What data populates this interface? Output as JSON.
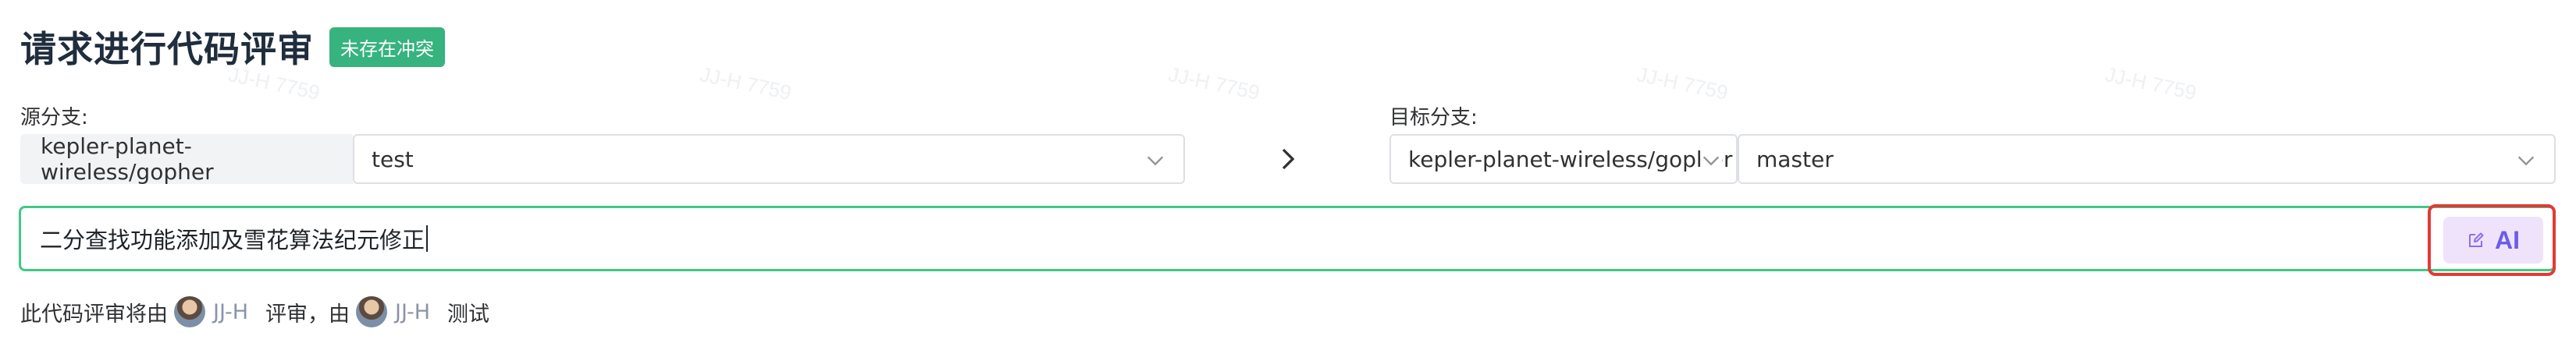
{
  "header": {
    "title": "请求进行代码评审",
    "conflict_badge": "未存在冲突"
  },
  "source": {
    "label": "源分支:",
    "repo": "kepler-planet-wireless/gopher",
    "branch": "test"
  },
  "target": {
    "label": "目标分支:",
    "repo": "kepler-planet-wireless/gopher",
    "branch": "master"
  },
  "review_title": {
    "value": "二分查找功能添加及雪花算法纪元修正"
  },
  "ai_button": {
    "label": "AI"
  },
  "reviewers": {
    "prefix": "此代码评审将由",
    "reviewer": "JJ-H",
    "middle": "评审，由",
    "tester": "JJ-H",
    "suffix": "测试"
  },
  "watermark": "JJ-H 7759",
  "colors": {
    "badge": "#36b37e",
    "input_focus_border": "#3fc985",
    "highlight_border": "#e53935",
    "ai_accent": "#6c5ce7"
  }
}
